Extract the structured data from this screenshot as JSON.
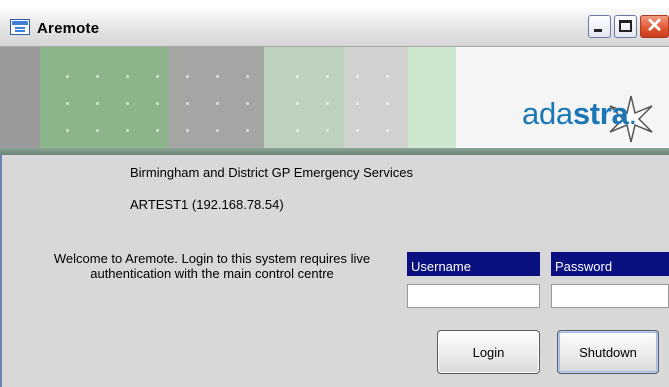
{
  "window": {
    "title": "Aremote",
    "controls": [
      "minimize",
      "maximize",
      "close"
    ],
    "close_glyph": "✕"
  },
  "banner": {
    "logo_part1": "ada",
    "logo_part2": "stra",
    "logo_dot": ".",
    "star_icon": "star-icon",
    "colors": {
      "logo": "#1b76b6",
      "stripe": "#6d8778"
    }
  },
  "info": {
    "organisation": "Birmingham and District GP Emergency Services",
    "host": "ARTEST1 (192.168.78.54)"
  },
  "welcome": {
    "line1": "Welcome to Aremote. Login to this system requires live",
    "line2": "authentication with the main control centre"
  },
  "login": {
    "username_label": "Username",
    "username_value": "",
    "password_label": "Password",
    "password_value": "",
    "label_color": "#0b1080"
  },
  "buttons": {
    "login": "Login",
    "shutdown": "Shutdown"
  }
}
